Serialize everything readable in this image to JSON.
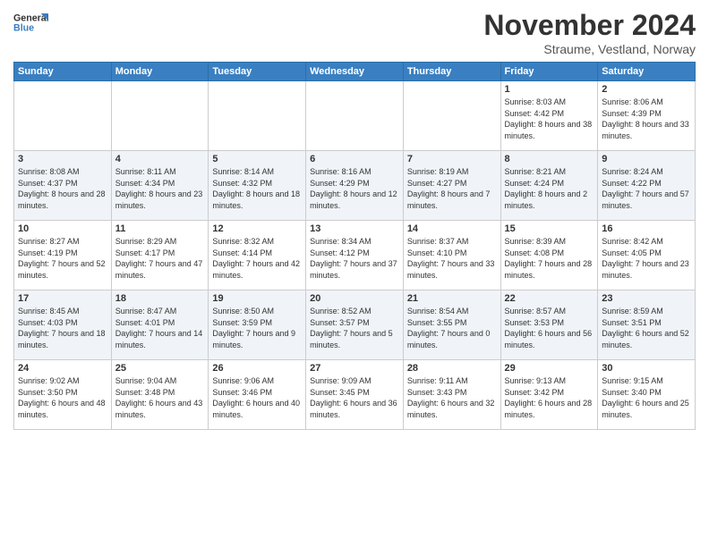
{
  "header": {
    "logo_general": "General",
    "logo_blue": "Blue",
    "title": "November 2024",
    "location": "Straume, Vestland, Norway"
  },
  "days_of_week": [
    "Sunday",
    "Monday",
    "Tuesday",
    "Wednesday",
    "Thursday",
    "Friday",
    "Saturday"
  ],
  "weeks": [
    [
      {
        "day": "",
        "info": ""
      },
      {
        "day": "",
        "info": ""
      },
      {
        "day": "",
        "info": ""
      },
      {
        "day": "",
        "info": ""
      },
      {
        "day": "",
        "info": ""
      },
      {
        "day": "1",
        "info": "Sunrise: 8:03 AM\nSunset: 4:42 PM\nDaylight: 8 hours and 38 minutes."
      },
      {
        "day": "2",
        "info": "Sunrise: 8:06 AM\nSunset: 4:39 PM\nDaylight: 8 hours and 33 minutes."
      }
    ],
    [
      {
        "day": "3",
        "info": "Sunrise: 8:08 AM\nSunset: 4:37 PM\nDaylight: 8 hours and 28 minutes."
      },
      {
        "day": "4",
        "info": "Sunrise: 8:11 AM\nSunset: 4:34 PM\nDaylight: 8 hours and 23 minutes."
      },
      {
        "day": "5",
        "info": "Sunrise: 8:14 AM\nSunset: 4:32 PM\nDaylight: 8 hours and 18 minutes."
      },
      {
        "day": "6",
        "info": "Sunrise: 8:16 AM\nSunset: 4:29 PM\nDaylight: 8 hours and 12 minutes."
      },
      {
        "day": "7",
        "info": "Sunrise: 8:19 AM\nSunset: 4:27 PM\nDaylight: 8 hours and 7 minutes."
      },
      {
        "day": "8",
        "info": "Sunrise: 8:21 AM\nSunset: 4:24 PM\nDaylight: 8 hours and 2 minutes."
      },
      {
        "day": "9",
        "info": "Sunrise: 8:24 AM\nSunset: 4:22 PM\nDaylight: 7 hours and 57 minutes."
      }
    ],
    [
      {
        "day": "10",
        "info": "Sunrise: 8:27 AM\nSunset: 4:19 PM\nDaylight: 7 hours and 52 minutes."
      },
      {
        "day": "11",
        "info": "Sunrise: 8:29 AM\nSunset: 4:17 PM\nDaylight: 7 hours and 47 minutes."
      },
      {
        "day": "12",
        "info": "Sunrise: 8:32 AM\nSunset: 4:14 PM\nDaylight: 7 hours and 42 minutes."
      },
      {
        "day": "13",
        "info": "Sunrise: 8:34 AM\nSunset: 4:12 PM\nDaylight: 7 hours and 37 minutes."
      },
      {
        "day": "14",
        "info": "Sunrise: 8:37 AM\nSunset: 4:10 PM\nDaylight: 7 hours and 33 minutes."
      },
      {
        "day": "15",
        "info": "Sunrise: 8:39 AM\nSunset: 4:08 PM\nDaylight: 7 hours and 28 minutes."
      },
      {
        "day": "16",
        "info": "Sunrise: 8:42 AM\nSunset: 4:05 PM\nDaylight: 7 hours and 23 minutes."
      }
    ],
    [
      {
        "day": "17",
        "info": "Sunrise: 8:45 AM\nSunset: 4:03 PM\nDaylight: 7 hours and 18 minutes."
      },
      {
        "day": "18",
        "info": "Sunrise: 8:47 AM\nSunset: 4:01 PM\nDaylight: 7 hours and 14 minutes."
      },
      {
        "day": "19",
        "info": "Sunrise: 8:50 AM\nSunset: 3:59 PM\nDaylight: 7 hours and 9 minutes."
      },
      {
        "day": "20",
        "info": "Sunrise: 8:52 AM\nSunset: 3:57 PM\nDaylight: 7 hours and 5 minutes."
      },
      {
        "day": "21",
        "info": "Sunrise: 8:54 AM\nSunset: 3:55 PM\nDaylight: 7 hours and 0 minutes."
      },
      {
        "day": "22",
        "info": "Sunrise: 8:57 AM\nSunset: 3:53 PM\nDaylight: 6 hours and 56 minutes."
      },
      {
        "day": "23",
        "info": "Sunrise: 8:59 AM\nSunset: 3:51 PM\nDaylight: 6 hours and 52 minutes."
      }
    ],
    [
      {
        "day": "24",
        "info": "Sunrise: 9:02 AM\nSunset: 3:50 PM\nDaylight: 6 hours and 48 minutes."
      },
      {
        "day": "25",
        "info": "Sunrise: 9:04 AM\nSunset: 3:48 PM\nDaylight: 6 hours and 43 minutes."
      },
      {
        "day": "26",
        "info": "Sunrise: 9:06 AM\nSunset: 3:46 PM\nDaylight: 6 hours and 40 minutes."
      },
      {
        "day": "27",
        "info": "Sunrise: 9:09 AM\nSunset: 3:45 PM\nDaylight: 6 hours and 36 minutes."
      },
      {
        "day": "28",
        "info": "Sunrise: 9:11 AM\nSunset: 3:43 PM\nDaylight: 6 hours and 32 minutes."
      },
      {
        "day": "29",
        "info": "Sunrise: 9:13 AM\nSunset: 3:42 PM\nDaylight: 6 hours and 28 minutes."
      },
      {
        "day": "30",
        "info": "Sunrise: 9:15 AM\nSunset: 3:40 PM\nDaylight: 6 hours and 25 minutes."
      }
    ]
  ]
}
